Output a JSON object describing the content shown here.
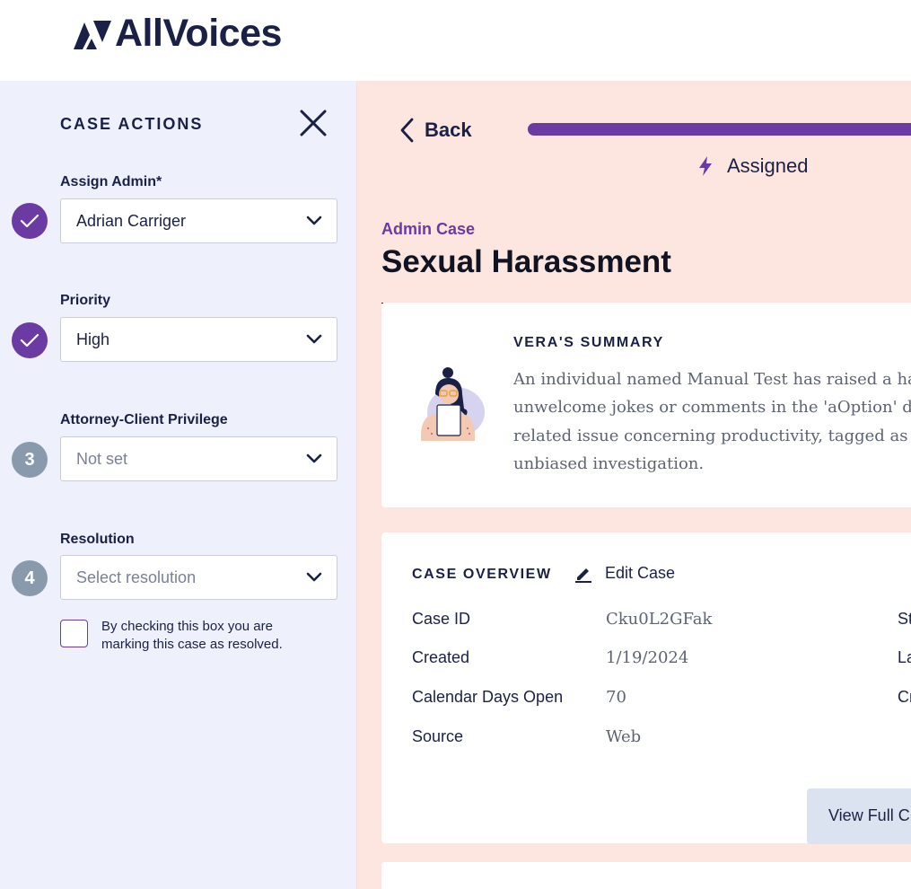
{
  "brand": {
    "name": "AllVoices"
  },
  "sidebar": {
    "title": "CASE ACTIONS",
    "assign_admin": {
      "label": "Assign Admin*",
      "value": "Adrian Carriger",
      "status": "done"
    },
    "priority": {
      "label": "Priority",
      "value": "High",
      "status": "done"
    },
    "privilege": {
      "label": "Attorney-Client Privilege",
      "value": "Not set",
      "step": "3"
    },
    "resolution": {
      "label": "Resolution",
      "value": "Select resolution",
      "step": "4"
    },
    "resolved_checkbox": {
      "text": "By checking this box you are marking this case as resolved.",
      "checked": false
    }
  },
  "main": {
    "back_label": "Back",
    "status_label": "Assigned",
    "case_type": "Admin Case",
    "case_title": "Sexual Harassment",
    "summary": {
      "title": "VERA'S SUMMARY",
      "lines": [
        "An individual named Manual Test has raised a haras",
        "unwelcome jokes or comments in the 'aOption' dep",
        "related issue concerning productivity, tagged as 'ato",
        "unbiased investigation."
      ]
    },
    "overview": {
      "title": "CASE OVERVIEW",
      "edit_label": "Edit Case",
      "rows": [
        {
          "label": "Case ID",
          "value": "Cku0L2GFak",
          "right": "St"
        },
        {
          "label": "Created",
          "value": "1/19/2024",
          "right": "La"
        },
        {
          "label": "Calendar Days Open",
          "value": "70",
          "right": "Cr"
        },
        {
          "label": "Source",
          "value": "Web",
          "right": ""
        }
      ],
      "view_full_label": "View Full C"
    }
  },
  "colors": {
    "accent": "#6b3aa3",
    "navy": "#1b2146",
    "main_bg": "#fde6df",
    "sidebar_bg": "#eef0fb",
    "step_gray": "#8a9aad"
  }
}
